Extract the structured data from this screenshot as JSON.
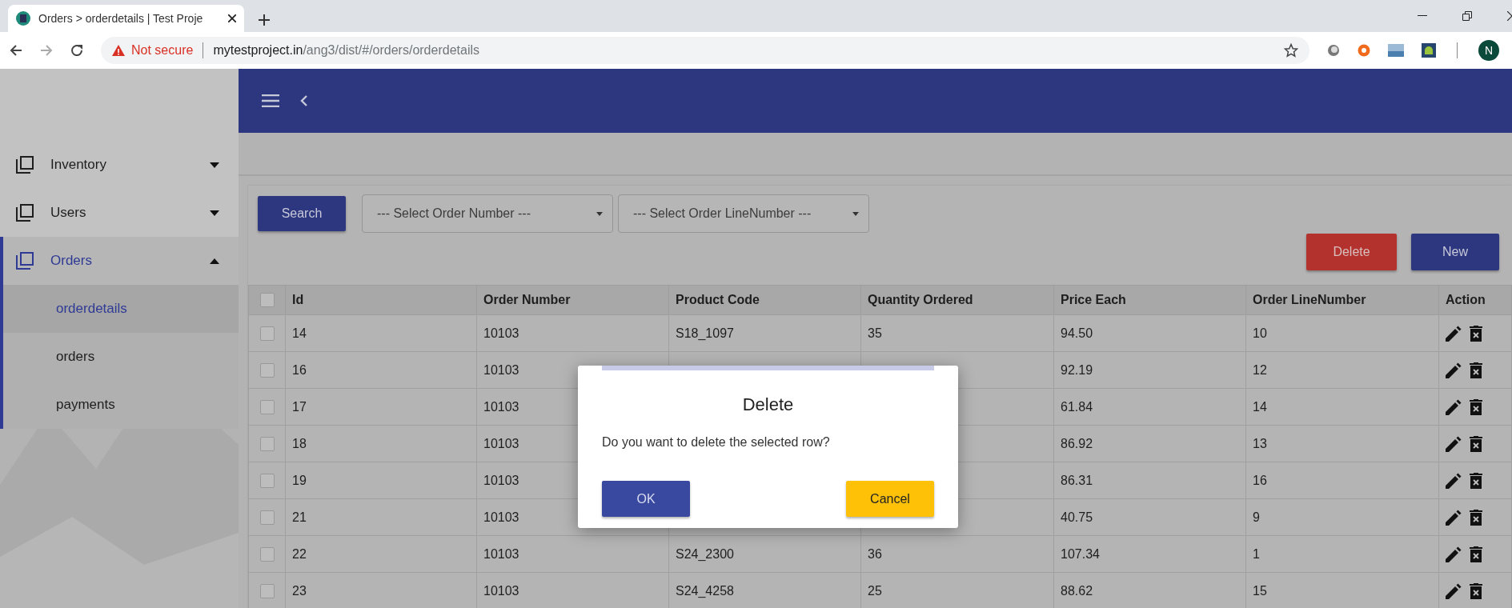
{
  "browser": {
    "tab_title": "Orders > orderdetails | Test Proje",
    "security": "Not secure",
    "host": "mytestproject.in",
    "path": "/ang3/dist/#/orders/orderdetails",
    "profile_initial": "N"
  },
  "sidebar": {
    "items": [
      {
        "label": "Inventory",
        "expanded": false,
        "selected": false
      },
      {
        "label": "Users",
        "expanded": false,
        "selected": false
      },
      {
        "label": "Orders",
        "expanded": true,
        "selected": true,
        "children": [
          {
            "label": "orderdetails",
            "selected": true
          },
          {
            "label": "orders",
            "selected": false
          },
          {
            "label": "payments",
            "selected": false
          }
        ]
      }
    ]
  },
  "toolbar": {
    "search_button": "Search",
    "selects": [
      {
        "value": "--- Select Order Number ---"
      },
      {
        "value": "--- Select Order LineNumber ---"
      }
    ],
    "delete_button": "Delete",
    "new_button": "New"
  },
  "table": {
    "select_all_checked": false,
    "columns": [
      "Id",
      "Order Number",
      "Product Code",
      "Quantity Ordered",
      "Price Each",
      "Order LineNumber",
      "Action"
    ],
    "rows": [
      {
        "checked": false,
        "id": "14",
        "order_number": "10103",
        "product_code": "S18_1097",
        "quantity_ordered": "35",
        "price_each": "94.50",
        "order_line_number": "10"
      },
      {
        "checked": false,
        "id": "16",
        "order_number": "10103",
        "price_each": "92.19",
        "order_line_number": "12"
      },
      {
        "checked": false,
        "id": "17",
        "order_number": "10103",
        "price_each": "61.84",
        "order_line_number": "14"
      },
      {
        "checked": false,
        "id": "18",
        "order_number": "10103",
        "price_each": "86.92",
        "order_line_number": "13"
      },
      {
        "checked": false,
        "id": "19",
        "order_number": "10103",
        "price_each": "86.31",
        "order_line_number": "16"
      },
      {
        "checked": false,
        "id": "21",
        "order_number": "10103",
        "price_each": "40.75",
        "order_line_number": "9"
      },
      {
        "checked": false,
        "id": "22",
        "order_number": "10103",
        "product_code": "S24_2300",
        "quantity_ordered": "36",
        "price_each": "107.34",
        "order_line_number": "1"
      },
      {
        "checked": false,
        "id": "23",
        "order_number": "10103",
        "product_code": "S24_4258",
        "quantity_ordered": "25",
        "price_each": "88.62",
        "order_line_number": "15"
      }
    ]
  },
  "dialog": {
    "title": "Delete",
    "message": "Do you want to delete the selected row?",
    "ok_button": "OK",
    "cancel_button": "Cancel"
  }
}
